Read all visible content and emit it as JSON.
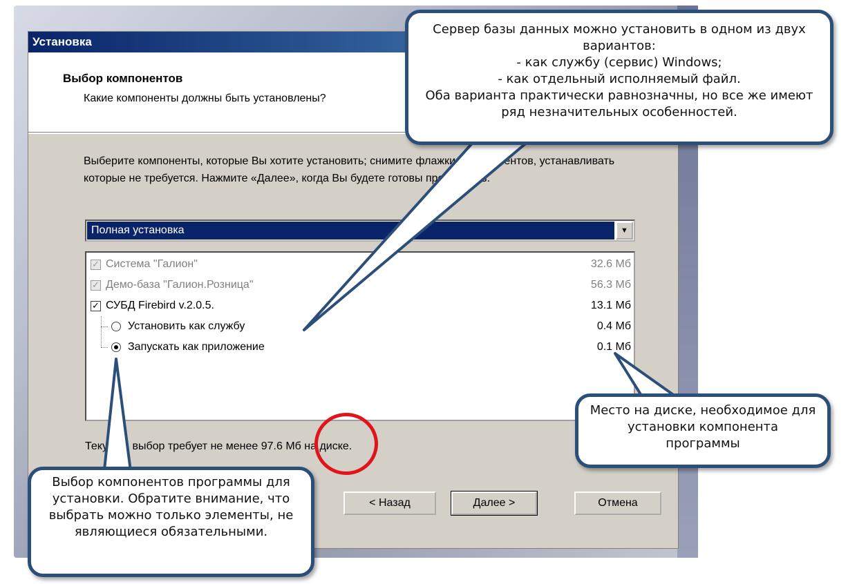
{
  "window": {
    "title": "Установка"
  },
  "header": {
    "title": "Выбор компонентов",
    "subtitle": "Какие компоненты должны быть установлены?"
  },
  "instructions": "Выберите компоненты, которые Вы хотите установить; снимите флажки с компонентов, устанавливать которые не требуется. Нажмите «Далее», когда Вы будете готовы продолжить.",
  "setup_type": {
    "selected": "Полная установка"
  },
  "components": [
    {
      "label": "Система \"Галион\"",
      "size": "32.6 Мб",
      "kind": "checkbox",
      "checked": true,
      "enabled": false
    },
    {
      "label": "Демо-база \"Галион.Розница\"",
      "size": "56.3 Мб",
      "kind": "checkbox",
      "checked": true,
      "enabled": false
    },
    {
      "label": "СУБД Firebird v.2.0.5.",
      "size": "13.1 Мб",
      "kind": "checkbox",
      "checked": true,
      "enabled": true
    },
    {
      "label": "Установить как службу",
      "size": "0.4 Мб",
      "kind": "radio",
      "checked": false,
      "enabled": true
    },
    {
      "label": "Запускать как приложение",
      "size": "0.1 Мб",
      "kind": "radio",
      "checked": true,
      "enabled": true
    }
  ],
  "space_required": {
    "prefix": "Текущий выбор требует не менее",
    "value": "97.6 Мб",
    "suffix": "на диске."
  },
  "buttons": {
    "back": "< Назад",
    "next": "Далее >",
    "cancel": "Отмена"
  },
  "callouts": {
    "server": "Сервер базы данных можно установить в одном из двух вариантов:\n- как службу (сервис) Windows;\n- как отдельный исполняемый файл.\nОба варианта практически равнозначны, но все же имеют ряд незначительных особенностей.",
    "disk": "Место на диске, необходимое для установки компонента программы",
    "select": "Выбор компонентов программы для установки. Обратите внимание, что выбрать можно только элементы, не являющиеся обязательными."
  },
  "colors": {
    "callout_border": "#2c4f7a",
    "highlight_circle": "#e0151b",
    "selection": "#0a246a"
  }
}
